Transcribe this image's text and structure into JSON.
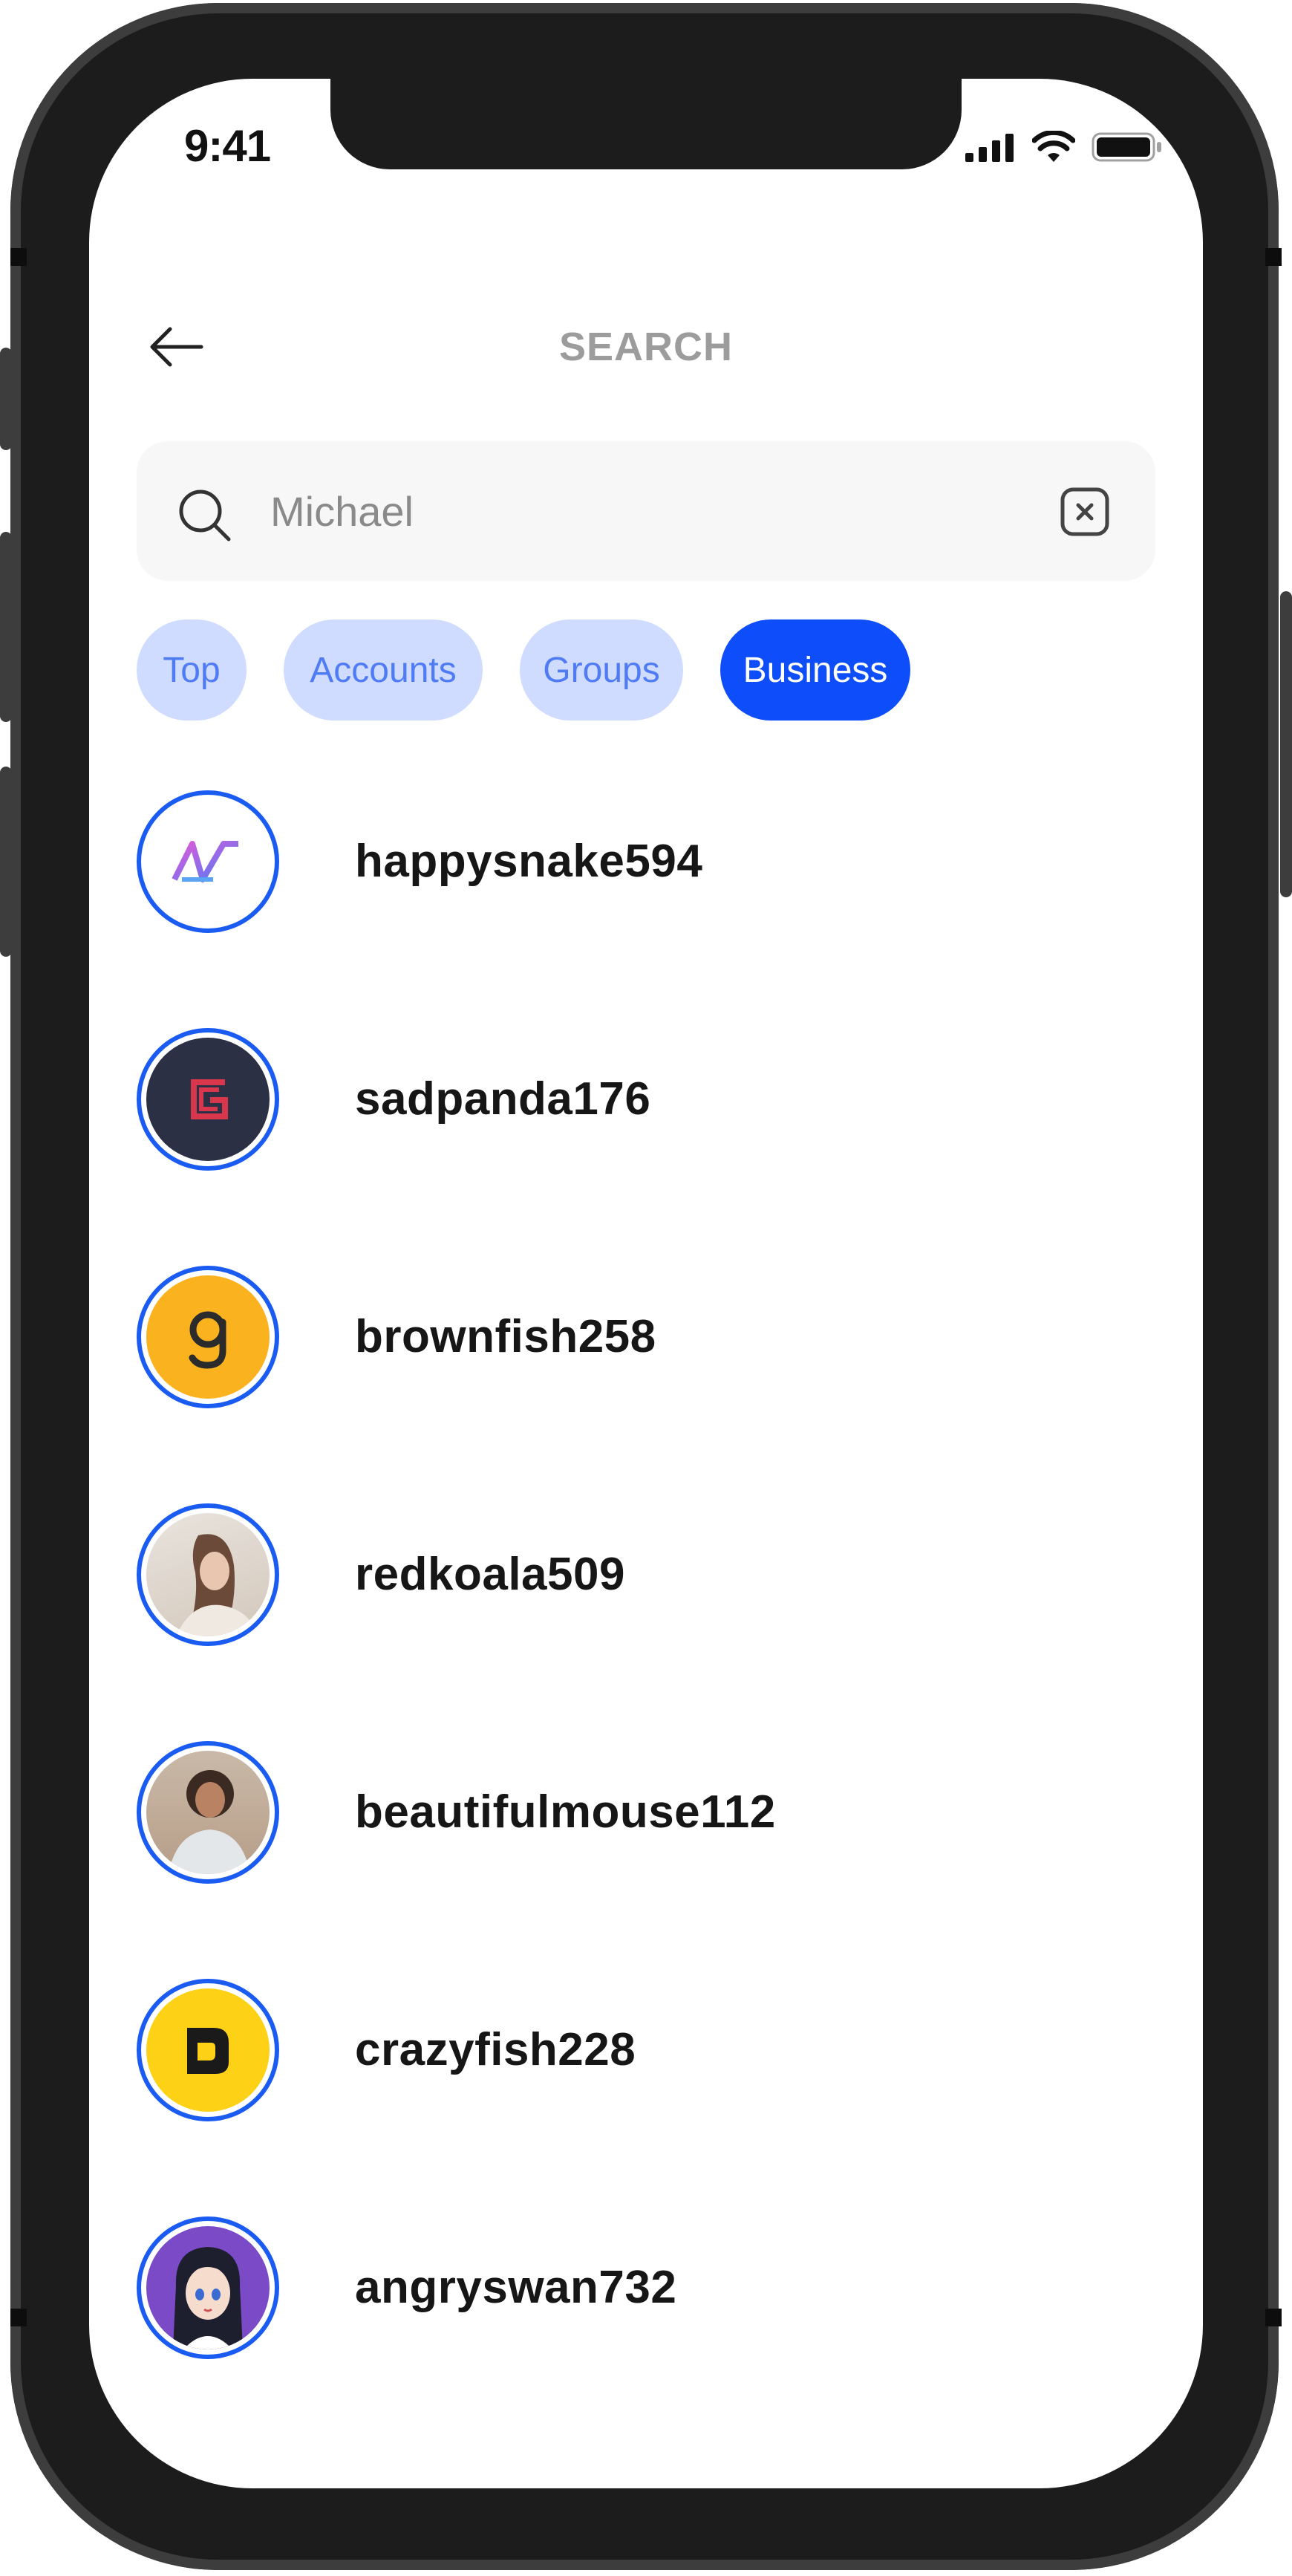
{
  "status_bar": {
    "time": "9:41"
  },
  "header": {
    "title": "SEARCH",
    "back_icon": "arrow-left-icon"
  },
  "search": {
    "value": "Michael",
    "icon": "search-icon",
    "clear_icon": "clear-x-icon"
  },
  "filters": [
    {
      "label": "Top",
      "active": false
    },
    {
      "label": "Accounts",
      "active": false
    },
    {
      "label": "Groups",
      "active": false
    },
    {
      "label": "Business",
      "active": true
    }
  ],
  "results": [
    {
      "username": "happysnake594",
      "avatar": "gradient-logo-avatar"
    },
    {
      "username": "sadpanda176",
      "avatar": "red-g-logo-avatar"
    },
    {
      "username": "brownfish258",
      "avatar": "orange-g-logo-avatar"
    },
    {
      "username": "redkoala509",
      "avatar": "woman-photo-avatar"
    },
    {
      "username": "beautifulmouse112",
      "avatar": "man-photo-avatar"
    },
    {
      "username": "crazyfish228",
      "avatar": "yellow-b-logo-avatar"
    },
    {
      "username": "angryswan732",
      "avatar": "anime-girl-avatar"
    }
  ],
  "colors": {
    "accent": "#0d4dfa",
    "chip_bg": "#cfdcff",
    "chip_text": "#4f7bf5",
    "ring": "#1a5cf2"
  }
}
